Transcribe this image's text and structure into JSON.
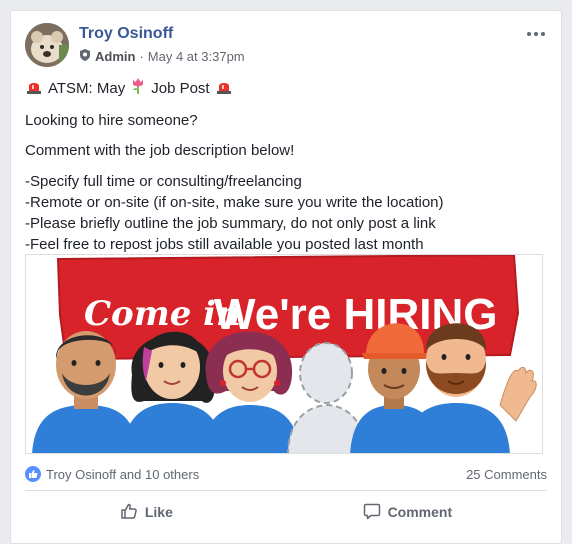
{
  "post": {
    "author": "Troy Osinoff",
    "role": "Admin",
    "timestamp": "May 4 at 3:37pm",
    "title_text_1": "ATSM: May",
    "title_text_2": "Job Post",
    "line_1": "Looking to hire someone?",
    "line_2": "Comment with the job description below!",
    "bullets": [
      "-Specify full time or consulting/freelancing",
      "-Remote or on-site (if on-site, make sure you write the location)",
      "-Please briefly outline the job summary, do not only post a link",
      "-Feel free to repost jobs still available you posted last month"
    ],
    "image": {
      "script_text": "Come in",
      "headline": "We're HIRING"
    }
  },
  "stats": {
    "reactions": "Troy Osinoff and 10 others",
    "comments": "25 Comments"
  },
  "actions": {
    "like": "Like",
    "comment": "Comment"
  },
  "colors": {
    "link": "#385898",
    "banner_red": "#d8232a",
    "like_blue": "#5890ff"
  }
}
